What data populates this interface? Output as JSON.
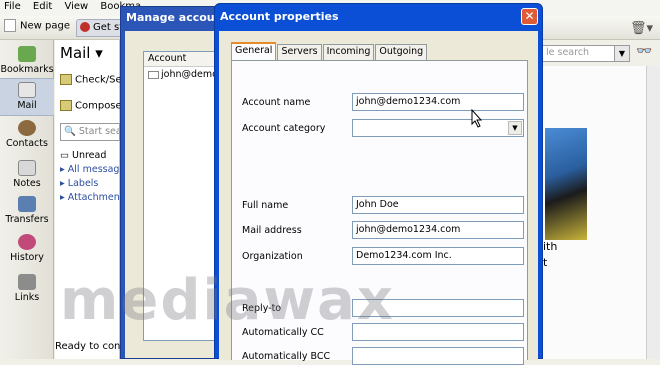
{
  "menubar": {
    "items": [
      "File",
      "Edit",
      "View",
      "Bookma"
    ]
  },
  "toolbar": {
    "new_page": "New page",
    "tab_label": "Get st"
  },
  "panels": [
    {
      "label": "Bookmarks",
      "icon": "bookmarks-icon"
    },
    {
      "label": "Mail",
      "icon": "mail-icon",
      "selected": true
    },
    {
      "label": "Contacts",
      "icon": "contacts-icon"
    },
    {
      "label": "Notes",
      "icon": "notes-icon"
    },
    {
      "label": "Transfers",
      "icon": "transfers-icon"
    },
    {
      "label": "History",
      "icon": "history-icon"
    },
    {
      "label": "Links",
      "icon": "links-icon"
    }
  ],
  "mail": {
    "title": "Mail ▾",
    "check_send": "Check/Se",
    "compose": "Compose",
    "search_placeholder": "Start sea",
    "tree": [
      "Unread",
      "All messag",
      "Labels",
      "Attachmen"
    ]
  },
  "right": {
    "search_placeholder": "le search",
    "text1": "ith",
    "text2": "t"
  },
  "status": "Ready to conn",
  "watermark": "mediawax",
  "manage": {
    "title": "Manage accounts",
    "column_header": "Account",
    "rows": [
      "john@demo1"
    ]
  },
  "props": {
    "title": "Account properties",
    "close": "✕",
    "tabs": [
      "General",
      "Servers",
      "Incoming",
      "Outgoing"
    ],
    "fields": {
      "account_name_label": "Account name",
      "account_name": "john@demo1234.com",
      "account_category_label": "Account category",
      "account_category": "",
      "full_name_label": "Full name",
      "full_name": "John Doe",
      "mail_address_label": "Mail address",
      "mail_address": "john@demo1234.com",
      "organization_label": "Organization",
      "organization": "Demo1234.com Inc.",
      "reply_to_label": "Reply-to",
      "reply_to": "",
      "auto_cc_label": "Automatically CC",
      "auto_cc": "",
      "auto_bcc_label": "Automatically BCC",
      "auto_bcc": ""
    }
  }
}
